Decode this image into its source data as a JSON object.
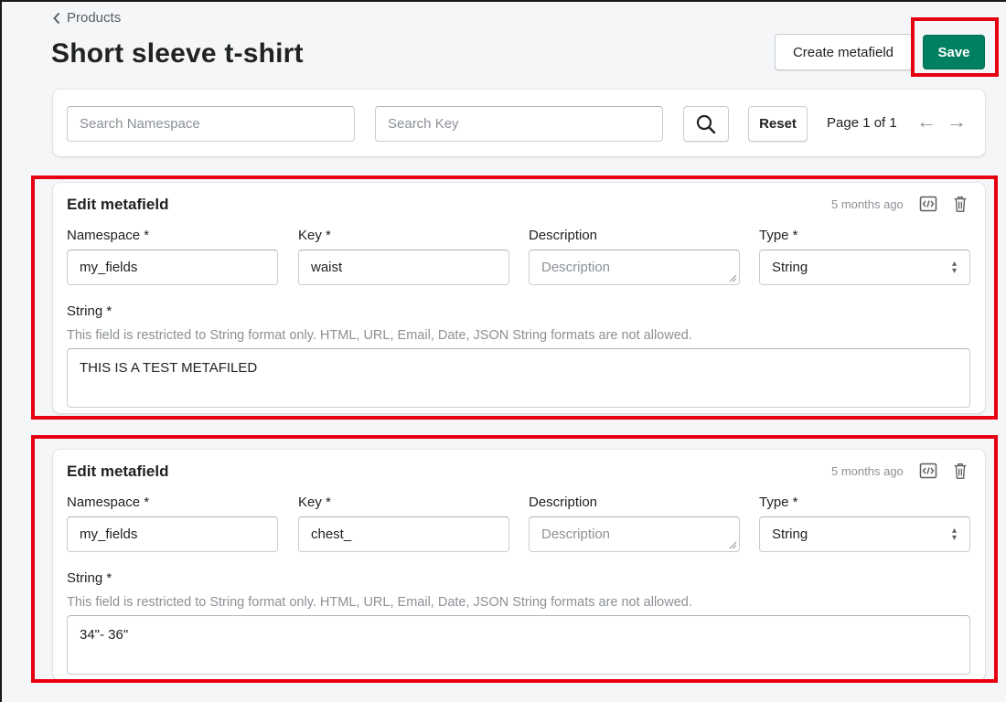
{
  "header": {
    "breadcrumb": "Products",
    "title": "Short sleeve t-shirt",
    "create_label": "Create metafield",
    "save_label": "Save"
  },
  "search": {
    "namespace_placeholder": "Search Namespace",
    "key_placeholder": "Search Key",
    "reset_label": "Reset",
    "page_info": "Page 1 of 1",
    "prev_arrow": "←",
    "next_arrow": "→"
  },
  "metafields": [
    {
      "title": "Edit metafield",
      "timestamp": "5 months ago",
      "namespace_label": "Namespace *",
      "namespace_value": "my_fields",
      "key_label": "Key *",
      "key_value": "waist",
      "description_label": "Description",
      "description_placeholder": "Description",
      "type_label": "Type *",
      "type_value": "String",
      "string_label": "String *",
      "help_text": "This field is restricted to String format only. HTML, URL, Email, Date, JSON String formats are not allowed.",
      "string_value": "THIS IS A TEST METAFILED"
    },
    {
      "title": "Edit metafield",
      "timestamp": "5 months ago",
      "namespace_label": "Namespace *",
      "namespace_value": "my_fields",
      "key_label": "Key *",
      "key_value": "chest_",
      "description_label": "Description",
      "description_placeholder": "Description",
      "type_label": "Type *",
      "type_value": "String",
      "string_label": "String *",
      "help_text": "This field is restricted to String format only. HTML, URL, Email, Date, JSON String formats are not allowed.",
      "string_value": "34\"- 36\""
    }
  ],
  "colors": {
    "primary_button": "#008060",
    "highlight_border": "#e60012",
    "background": "#f4f6f8"
  },
  "icons": [
    "chevron-left-icon",
    "search-icon",
    "code-icon",
    "trash-icon",
    "select-arrows-icon"
  ]
}
